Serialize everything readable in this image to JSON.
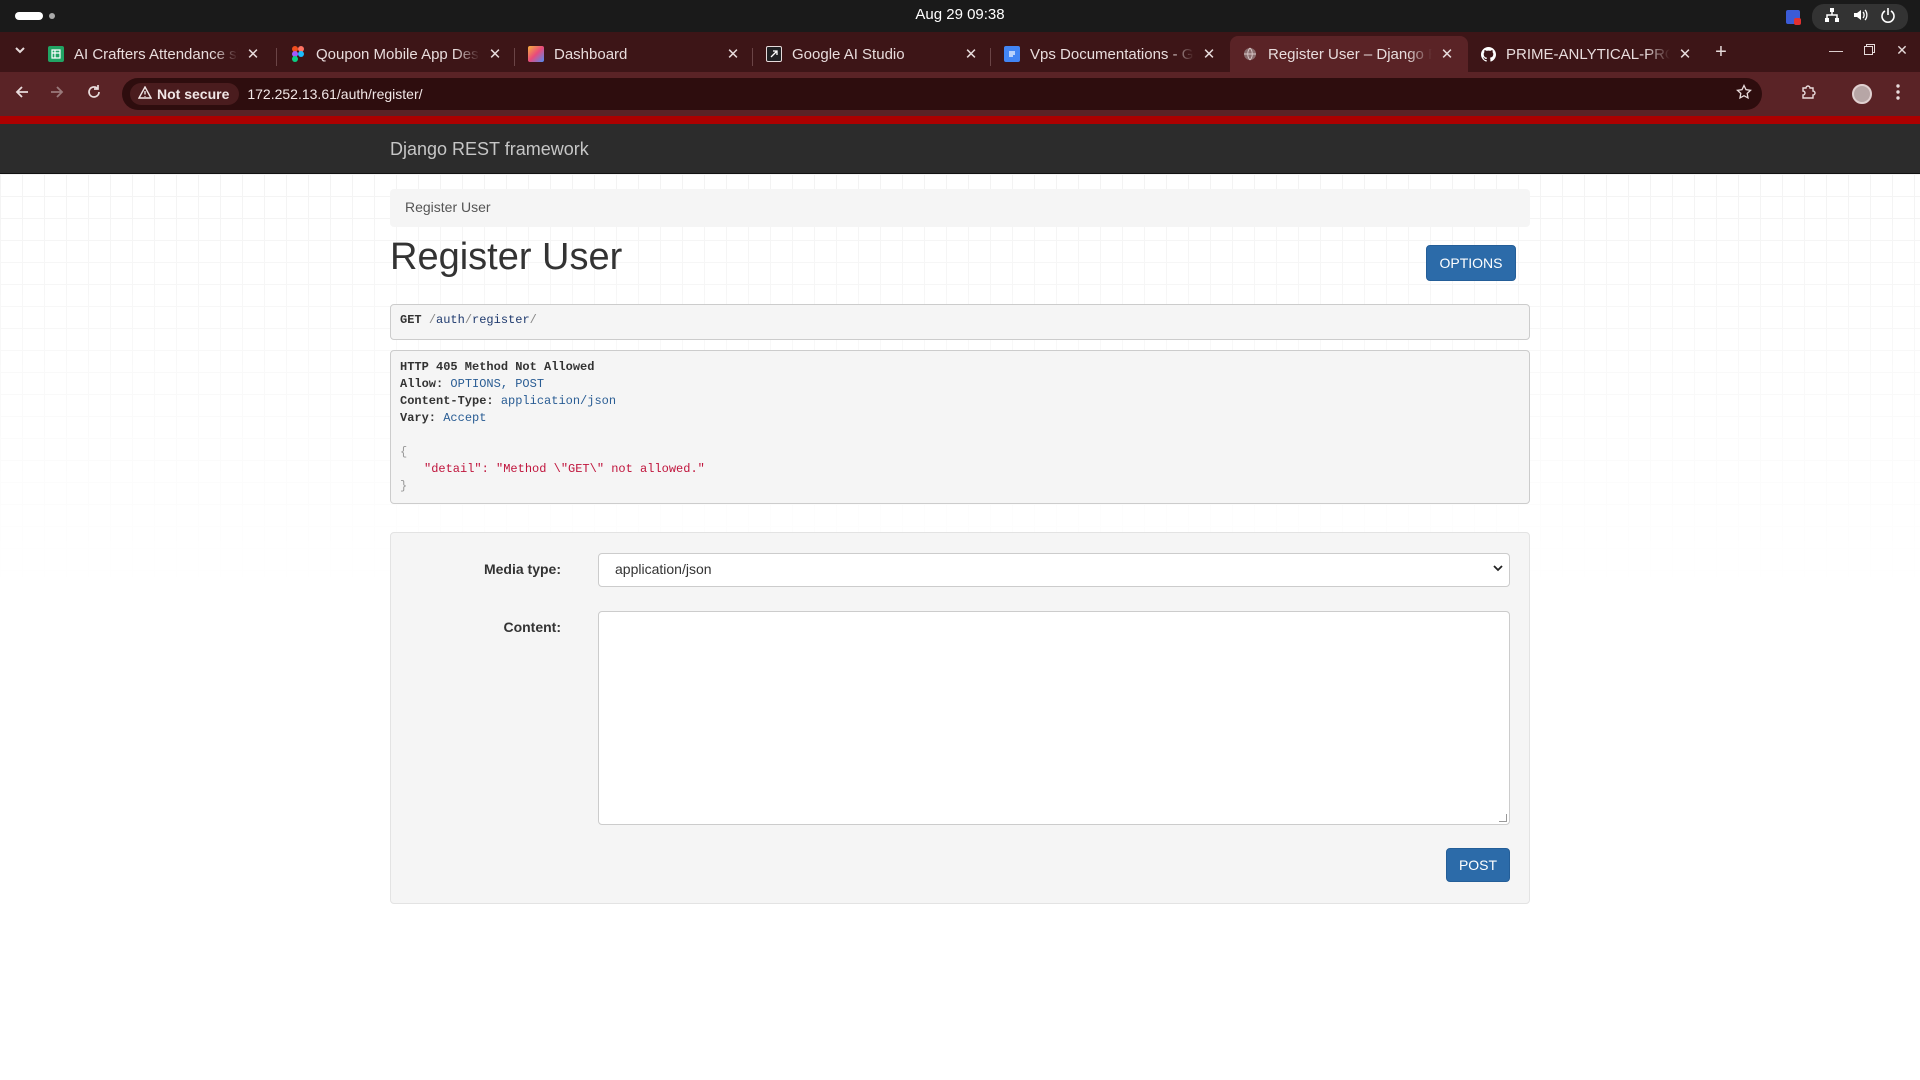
{
  "os": {
    "clock": "Aug 29  09:38"
  },
  "browser": {
    "tabs": [
      {
        "label": "AI Crafters Attendance sheet",
        "favicon": "google-sheets-icon",
        "color": "#21a464"
      },
      {
        "label": "Qoupon Mobile App Design",
        "favicon": "figma-icon",
        "color": "#f24e1e"
      },
      {
        "label": "Dashboard",
        "favicon": "dashboard-icon",
        "color": "#f6b23c"
      },
      {
        "label": "Google AI Studio",
        "favicon": "ai-studio-icon",
        "color": "#202124"
      },
      {
        "label": "Vps Documentations - Google Docs",
        "favicon": "google-docs-icon",
        "color": "#4285f4"
      },
      {
        "label": "Register User – Django REST framework",
        "favicon": "globe-icon",
        "color": "#8a6e6f"
      },
      {
        "label": "PRIME-ANLYTICAL-PROJECT",
        "favicon": "github-icon",
        "color": "#ffffff"
      }
    ],
    "active_tab_index": 5,
    "security_label": "Not secure",
    "url": "172.252.13.61/auth/register/"
  },
  "drf": {
    "brand": "Django REST framework",
    "breadcrumb": "Register User",
    "title": "Register User",
    "options_label": "OPTIONS",
    "request": {
      "method": "GET",
      "path_parts": [
        "auth",
        "register"
      ]
    },
    "response": {
      "status": "HTTP 405 Method Not Allowed",
      "headers": [
        {
          "key": "Allow:",
          "value": "OPTIONS, POST"
        },
        {
          "key": "Content-Type:",
          "value": "application/json"
        },
        {
          "key": "Vary:",
          "value": "Accept"
        }
      ],
      "open_brace": "{",
      "body_key": "\"detail\"",
      "body_colon": ": ",
      "body_value": "\"Method \\\"GET\\\" not allowed.\"",
      "close_brace": "}"
    },
    "form": {
      "media_type_label": "Media type:",
      "media_type_value": "application/json",
      "content_label": "Content:",
      "content_value": "",
      "post_label": "POST"
    }
  }
}
